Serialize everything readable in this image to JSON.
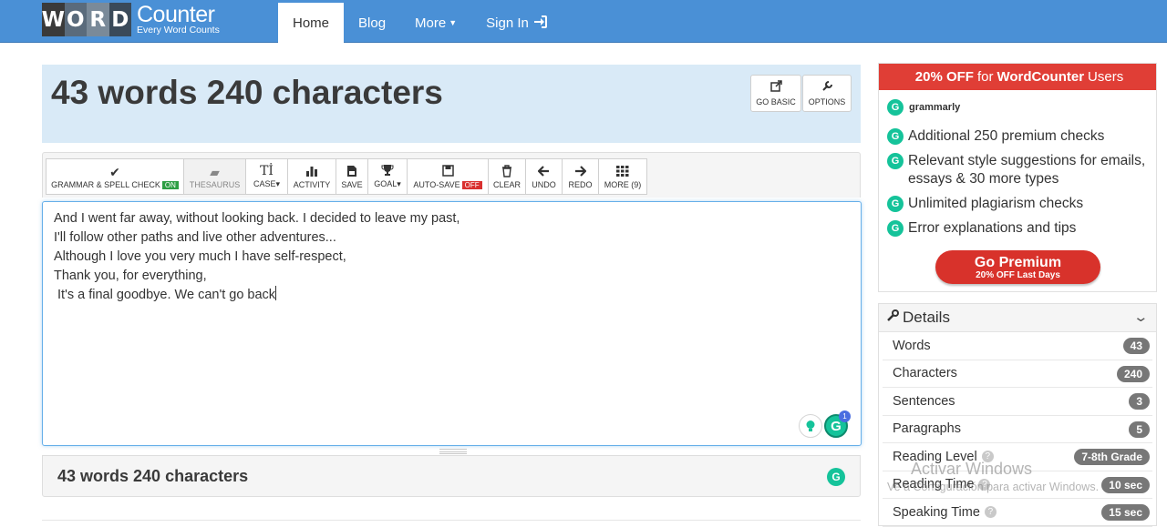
{
  "navbar": {
    "logo_letters": [
      "W",
      "O",
      "R",
      "D"
    ],
    "logo_letter_colors": [
      "#3a3a3a",
      "#5a6b7c",
      "#7a8a99",
      "#3a4a5a"
    ],
    "logo_title": "Counter",
    "logo_subtitle": "Every Word Counts",
    "items": [
      {
        "label": "Home",
        "active": true
      },
      {
        "label": "Blog"
      },
      {
        "label": "More"
      },
      {
        "label": "Sign In"
      }
    ],
    "colors": {
      "bar": "#4a90d6"
    }
  },
  "header": {
    "title": "43 words 240 characters",
    "go_basic_label": "GO BASIC",
    "options_label": "OPTIONS"
  },
  "toolbar": {
    "grammar_label": "GRAMMAR & SPELL CHECK",
    "grammar_state": "ON",
    "thesaurus_label": "THESAURUS",
    "case_label": "CASE",
    "case_icon": "Tİ",
    "activity_label": "ACTIVITY",
    "save_label": "SAVE",
    "goal_label": "GOAL",
    "autosave_label": "AUTO-SAVE",
    "autosave_state": "OFF",
    "clear_label": "CLEAR",
    "undo_label": "UNDO",
    "redo_label": "REDO",
    "more_label": "MORE (9)"
  },
  "editor": {
    "lines": [
      "And I went far away, without looking back. I decided to leave my past,",
      "I'll follow other paths and live other adventures...",
      "Although I love you very much I have self-respect,",
      "Thank you, for everything,",
      " It's a final goodbye. We can't go back"
    ],
    "grammarly_alert_count": "1"
  },
  "footer": {
    "title": "43 words 240 characters"
  },
  "promo": {
    "header_prefix": "20% OFF",
    "header_mid": "for",
    "header_brand": "WordCounter",
    "header_suffix": "Users",
    "brand": "grammarly",
    "items": [
      "Additional 250 premium checks",
      "Relevant style suggestions for emails, essays & 30 more types",
      "Unlimited plagiarism checks",
      "Error explanations and tips"
    ],
    "button_main": "Go Premium",
    "button_sub": "20% OFF Last Days",
    "colors": {
      "header": "#e03e36",
      "button": "#d8322b",
      "grammarly": "#15c39a"
    }
  },
  "details": {
    "title": "Details",
    "rows": [
      {
        "label": "Words",
        "value": "43"
      },
      {
        "label": "Characters",
        "value": "240"
      },
      {
        "label": "Sentences",
        "value": "3"
      },
      {
        "label": "Paragraphs",
        "value": "5"
      },
      {
        "label": "Reading Level",
        "value": "7-8th Grade"
      },
      {
        "label": "Reading Time",
        "value": "10 sec"
      },
      {
        "label": "Speaking Time",
        "value": "15 sec"
      }
    ]
  },
  "watermark": {
    "title": "Activar Windows",
    "subtitle": "Ve a Configuración para activar Windows."
  }
}
